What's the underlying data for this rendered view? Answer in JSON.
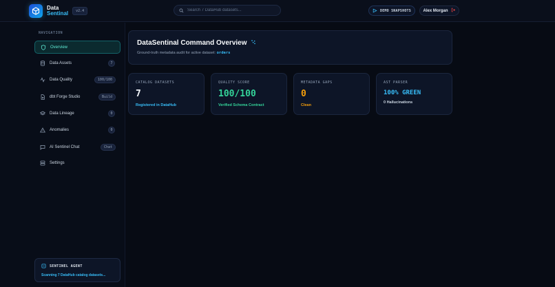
{
  "header": {
    "brand_line1": "Data",
    "brand_line2": "Sentinal",
    "version": "v2.4",
    "search_placeholder": "Search 7 DataHub datasets...",
    "demo_button": "DEMO SNAPSHOTS",
    "user_name": "Alex Morgan",
    "icons": [
      "logo-cube-icon",
      "search-icon",
      "snapshot-icon",
      "logout-icon"
    ]
  },
  "sidebar": {
    "section_title": "NAVIGATION",
    "items": [
      {
        "label": "Overview",
        "icon": "shield-icon",
        "badge": ""
      },
      {
        "label": "Data Assets",
        "icon": "database-icon",
        "badge": "7"
      },
      {
        "label": "Data Quality",
        "icon": "activity-icon",
        "badge": "100/100"
      },
      {
        "label": "dbt Forge Studio",
        "icon": "file-code-icon",
        "badge": "Build"
      },
      {
        "label": "Data Lineage",
        "icon": "layers-icon",
        "badge": "0"
      },
      {
        "label": "Anomalies",
        "icon": "alert-triangle-icon",
        "badge": "0"
      },
      {
        "label": "AI Sentinel Chat",
        "icon": "chat-icon",
        "badge": "Chat"
      },
      {
        "label": "Settings",
        "icon": "server-icon",
        "badge": ""
      }
    ],
    "active_index": 0,
    "agent": {
      "title": "SENTINEL AGENT",
      "status": "Scanning 7 DataHub catalog datasets..."
    }
  },
  "overview": {
    "title": "DataSentinal Command Overview",
    "subtitle": "Ground-truth metadata audit for active dataset:",
    "dataset": "orders"
  },
  "kpis": [
    {
      "label": "CATALOG DATASETS",
      "value": "7",
      "footer": "Registered in DataHub",
      "value_color": "#f1f5f9",
      "footer_color": "#38bdf8"
    },
    {
      "label": "QUALITY SCORE",
      "value": "100/100",
      "footer": "Verified Schema Contract",
      "value_color": "#34d399",
      "footer_color": "#34d399"
    },
    {
      "label": "METADATA GAPS",
      "value": "0",
      "footer": "Clean",
      "value_color": "#f59e0b",
      "footer_color": "#f59e0b"
    },
    {
      "label": "AST PARSER",
      "value": "100% GREEN",
      "footer": "0 Hallucinations",
      "value_color": "#38bdf8",
      "footer_color": "#cbd5e1"
    }
  ],
  "colors": {
    "background": "#070b14",
    "accent": "#38bdf8",
    "active_nav": "#5eead4",
    "danger": "#ef4444"
  }
}
